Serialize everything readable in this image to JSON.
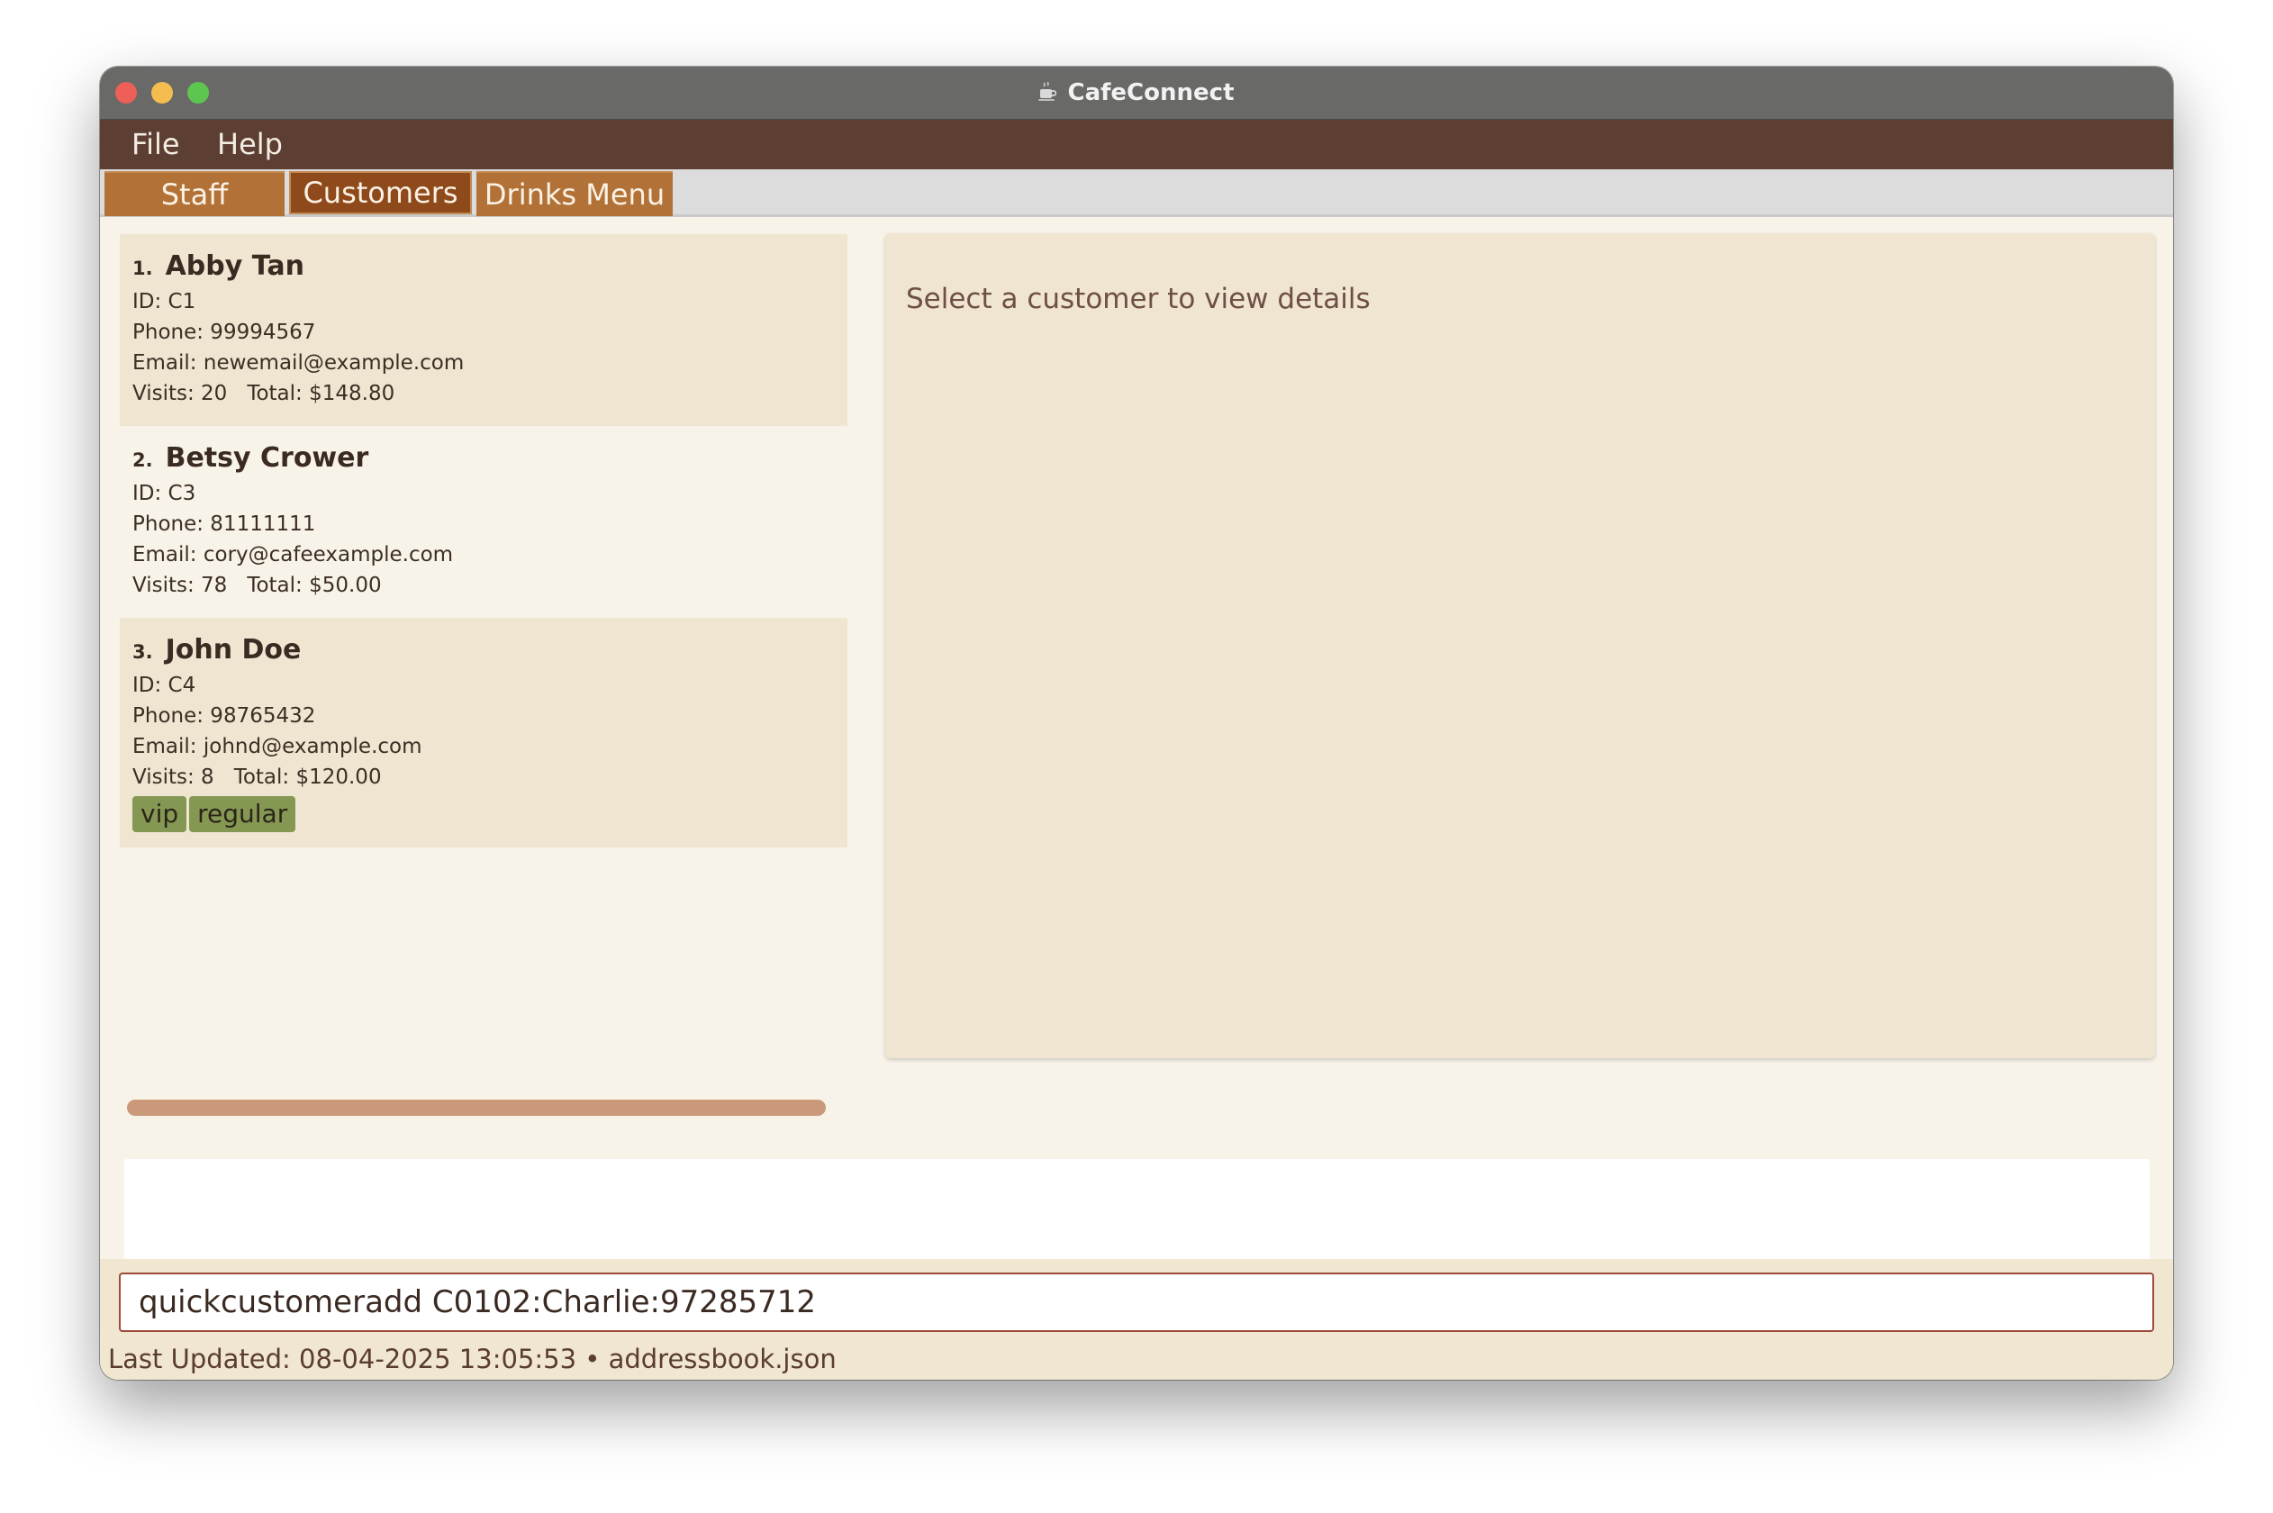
{
  "window": {
    "title": "CafeConnect"
  },
  "menu": {
    "file": "File",
    "help": "Help"
  },
  "tabs": [
    {
      "label": "Staff"
    },
    {
      "label": "Customers"
    },
    {
      "label": "Drinks Menu"
    }
  ],
  "active_tab": "Customers",
  "customers": [
    {
      "index": "1.",
      "name": "Abby Tan",
      "id": "ID: C1",
      "phone": "Phone: 99994567",
      "email": "Email: newemail@example.com",
      "visits": "Visits: 20",
      "total": "Total: $148.80",
      "tags": []
    },
    {
      "index": "2.",
      "name": "Betsy Crower",
      "id": "ID: C3",
      "phone": "Phone: 81111111",
      "email": "Email: cory@cafeexample.com",
      "visits": "Visits: 78",
      "total": "Total: $50.00",
      "tags": []
    },
    {
      "index": "3.",
      "name": "John Doe",
      "id": "ID: C4",
      "phone": "Phone: 98765432",
      "email": "Email: johnd@example.com",
      "visits": "Visits: 8",
      "total": "Total: $120.00",
      "tags": [
        "vip",
        "regular"
      ]
    }
  ],
  "detail": {
    "placeholder": "Select a customer to view details"
  },
  "command": {
    "value": "quickcustomeradd C0102:Charlie:97285712"
  },
  "status_bar": {
    "text": "Last Updated: 08-04-2025 13:05:53 • addressbook.json"
  },
  "colors": {
    "menubar": "#5d3e33",
    "tab": "#b27237",
    "tab_active": "#8f4a1b",
    "card": "#f0e5d0",
    "tag": "#849853",
    "input_border": "#9d4a3a"
  }
}
